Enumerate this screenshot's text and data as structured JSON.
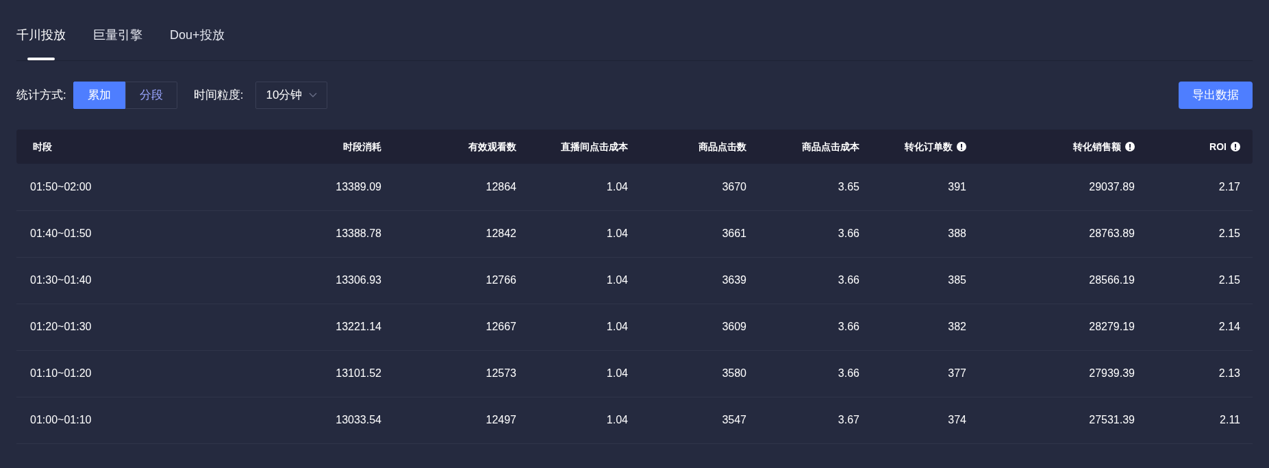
{
  "tabs": [
    {
      "label": "千川投放",
      "selected": true
    },
    {
      "label": "巨量引擎",
      "selected": false
    },
    {
      "label": "Dou+投放",
      "selected": false
    }
  ],
  "toolbar": {
    "mode_label": "统计方式:",
    "modes": [
      {
        "label": "累加",
        "selected": true
      },
      {
        "label": "分段",
        "selected": false
      }
    ],
    "granularity_label": "时间粒度:",
    "granularity": "10分钟",
    "export_button": "导出数据"
  },
  "table": {
    "columns": [
      {
        "label": "时段",
        "info": false
      },
      {
        "label": "时段消耗",
        "info": false
      },
      {
        "label": "有效观看数",
        "info": false
      },
      {
        "label": "直播间点击成本",
        "info": false
      },
      {
        "label": "商品点击数",
        "info": false
      },
      {
        "label": "商品点击成本",
        "info": false
      },
      {
        "label": "转化订单数",
        "info": true
      },
      {
        "label": "转化销售额",
        "info": true
      },
      {
        "label": "ROI",
        "info": true
      }
    ],
    "rows": [
      [
        "01:50~02:00",
        "13389.09",
        "12864",
        "1.04",
        "3670",
        "3.65",
        "391",
        "29037.89",
        "2.17"
      ],
      [
        "01:40~01:50",
        "13388.78",
        "12842",
        "1.04",
        "3661",
        "3.66",
        "388",
        "28763.89",
        "2.15"
      ],
      [
        "01:30~01:40",
        "13306.93",
        "12766",
        "1.04",
        "3639",
        "3.66",
        "385",
        "28566.19",
        "2.15"
      ],
      [
        "01:20~01:30",
        "13221.14",
        "12667",
        "1.04",
        "3609",
        "3.66",
        "382",
        "28279.19",
        "2.14"
      ],
      [
        "01:10~01:20",
        "13101.52",
        "12573",
        "1.04",
        "3580",
        "3.66",
        "377",
        "27939.39",
        "2.13"
      ],
      [
        "01:00~01:10",
        "13033.54",
        "12497",
        "1.04",
        "3547",
        "3.67",
        "374",
        "27531.39",
        "2.11"
      ]
    ]
  }
}
